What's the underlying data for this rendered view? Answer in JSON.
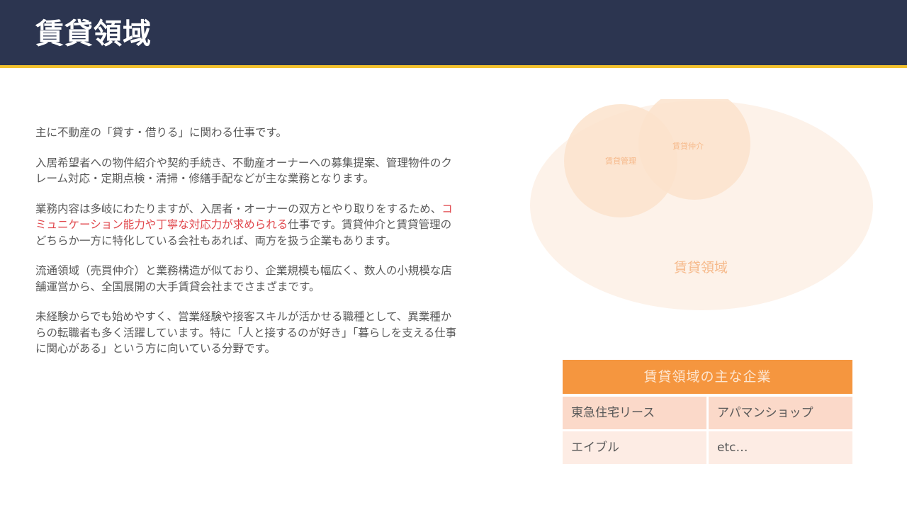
{
  "slide": {
    "title": "賃貸領域"
  },
  "body": {
    "paragraphs": [
      [
        "主に不動産の「貸す・借りる」に関わる仕事です。"
      ],
      [
        "入居希望者への物件紹介や契約手続き、不動産オーナーへの募集提案、管理物件のクレーム対応・定期点検・清掃・修繕手配などが主な業務となります。"
      ],
      [
        "業務内容は多岐にわたりますが、入居者・オーナーの双方とやり取りをするため、",
        "コミュニケーション能力や丁寧な対応力が求められる",
        "仕事です。賃貸仲介と賃貸管理のどちらか一方に特化している会社もあれば、両方を扱う企業もあります。"
      ],
      [
        "流通領域（売買仲介）と業務構造が似ており、企業規模も幅広く、数人の小規模な店舗運営から、全国展開の大手賃貸会社までさまざまです。"
      ],
      [
        "未経験からでも始めやすく、営業経験や接客スキルが活かせる職種として、異業種からの転職者も多く活躍しています。特に「人と接するのが好き」「暮らしを支える仕事に関心がある」という方に向いている分野です。"
      ]
    ]
  },
  "diagram": {
    "outer_label": "賃貸領域",
    "left_label": "賃貸管理",
    "right_label": "賃貸仲介",
    "outer_color": "#fdf2e9",
    "inner_color": "#fce3cd",
    "label_color": "#f6b98a"
  },
  "companies": {
    "header": "賃貸領域の主な企業",
    "rows": [
      [
        "東急住宅リース",
        "アパマンショップ"
      ],
      [
        "エイブル",
        "etc…"
      ]
    ],
    "header_color": "#f5963f"
  },
  "colors": {
    "header_bg": "#2c3550",
    "accent_rule": "#f2c12e",
    "highlight": "#e0474c"
  }
}
